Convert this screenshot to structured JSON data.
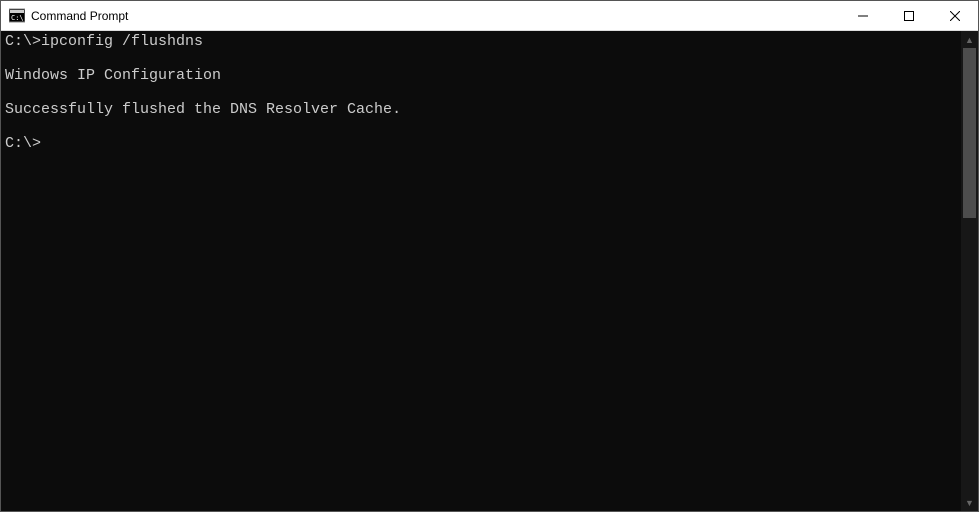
{
  "window": {
    "title": "Command Prompt"
  },
  "terminal": {
    "lines": [
      "C:\\>ipconfig /flushdns",
      "",
      "Windows IP Configuration",
      "",
      "Successfully flushed the DNS Resolver Cache.",
      "",
      "C:\\>"
    ]
  }
}
